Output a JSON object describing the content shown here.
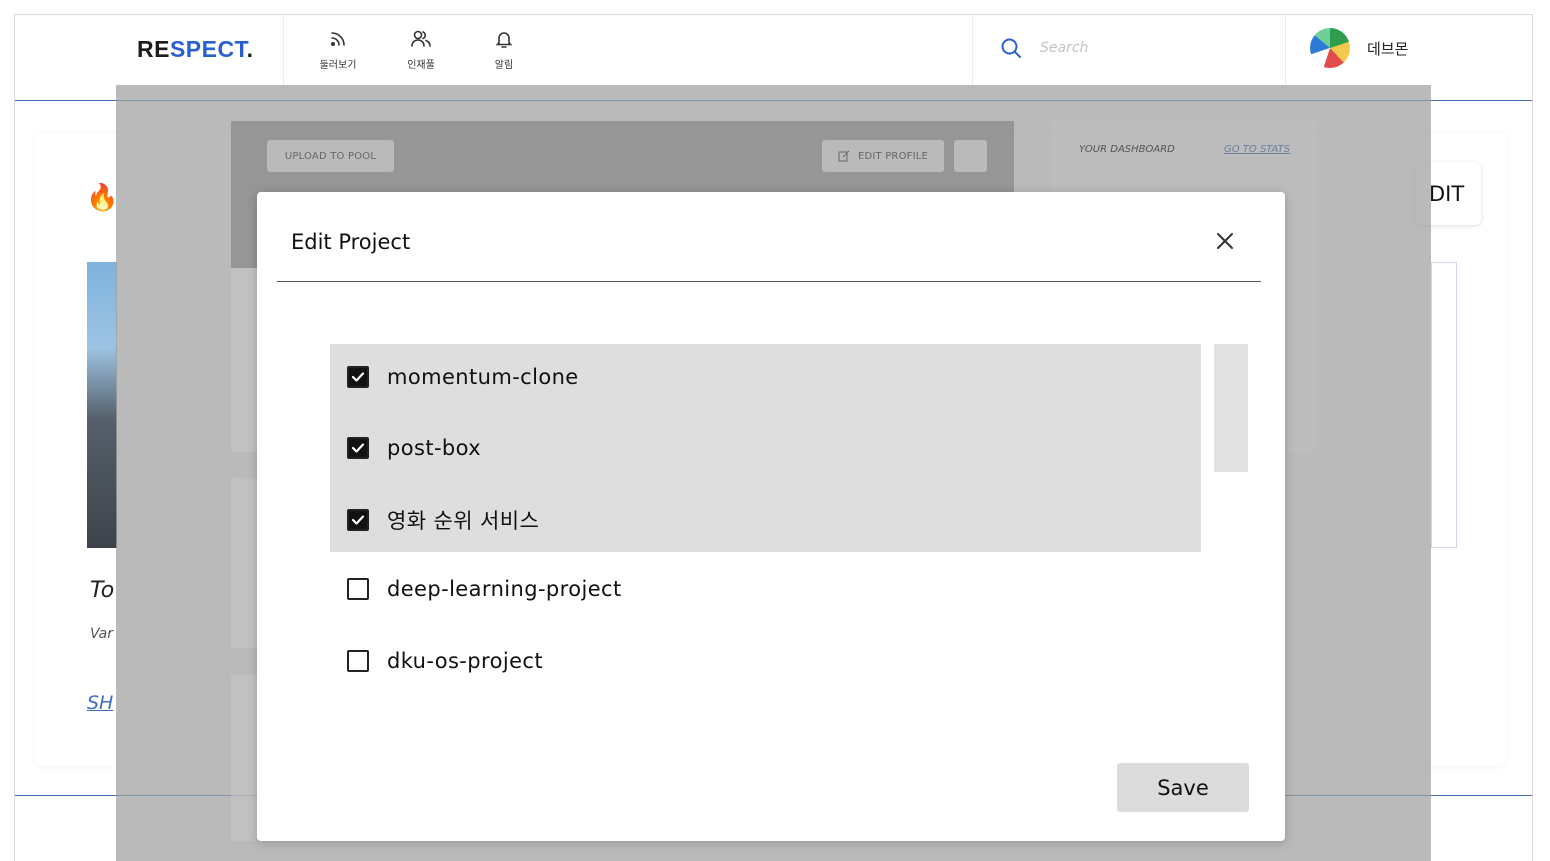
{
  "header": {
    "logo_prefix": "RE",
    "logo_accent": "SPECT",
    "logo_suffix": ".",
    "nav": [
      {
        "label": "둘러보기",
        "icon": "feed-icon"
      },
      {
        "label": "인재풀",
        "icon": "people-icon"
      },
      {
        "label": "알림",
        "icon": "bell-icon"
      }
    ],
    "search_placeholder": "Search",
    "user_name": "데브몬"
  },
  "background": {
    "card_title_start": "To",
    "card_subtitle_start": "Var",
    "show_link_start": "SH",
    "edit_button_partial": "DIT",
    "upload_button": "UPLOAD TO POOL",
    "edit_profile_button": "EDIT PROFILE",
    "dashboard_title": "YOUR DASHBOARD",
    "dashboard_link": "GO TO STATS"
  },
  "modal": {
    "title": "Edit Project",
    "items": [
      {
        "label": "momentum-clone",
        "checked": true
      },
      {
        "label": "post-box",
        "checked": true
      },
      {
        "label": "영화 순위 서비스",
        "checked": true
      },
      {
        "label": "deep-learning-project",
        "checked": false
      },
      {
        "label": "dku-os-project",
        "checked": false
      }
    ],
    "save_label": "Save"
  },
  "colors": {
    "brand_blue": "#2a5fcf",
    "divider_blue": "#3f6fb8",
    "overlay": "#a0a0a0",
    "selected_bg": "#dedede"
  }
}
